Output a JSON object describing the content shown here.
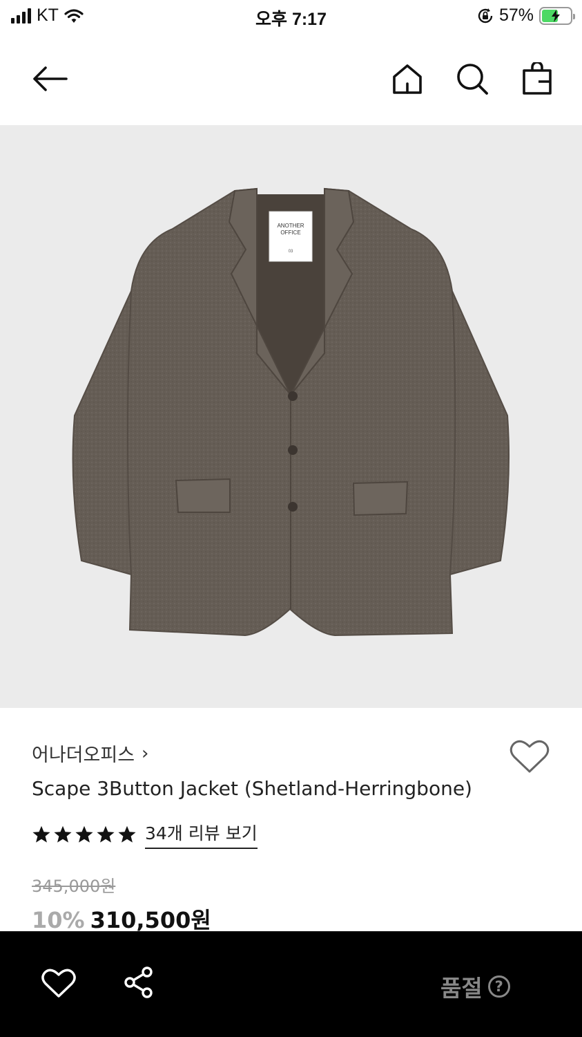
{
  "status_bar": {
    "carrier": "KT",
    "time": "오후 7:17",
    "battery_percent": "57%",
    "battery_level": 0.57
  },
  "product": {
    "label_line1": "ANOTHER",
    "label_line2": "OFFICE",
    "label_size": "03",
    "brand": "어나더오피스",
    "brand_chevron": "›",
    "title": "Scape 3Button Jacket (Shetland-Herringbone)",
    "rating": 5,
    "review_link": "34개 리뷰 보기",
    "original_price": "345,000원",
    "discount": "10%",
    "price": "310,500원"
  },
  "bottom_bar": {
    "status": "품절",
    "help": "?"
  },
  "colors": {
    "hero_bg": "#ebebeb",
    "jacket": "#655d55",
    "bottom_bar": "#000000",
    "muted": "#888888"
  }
}
